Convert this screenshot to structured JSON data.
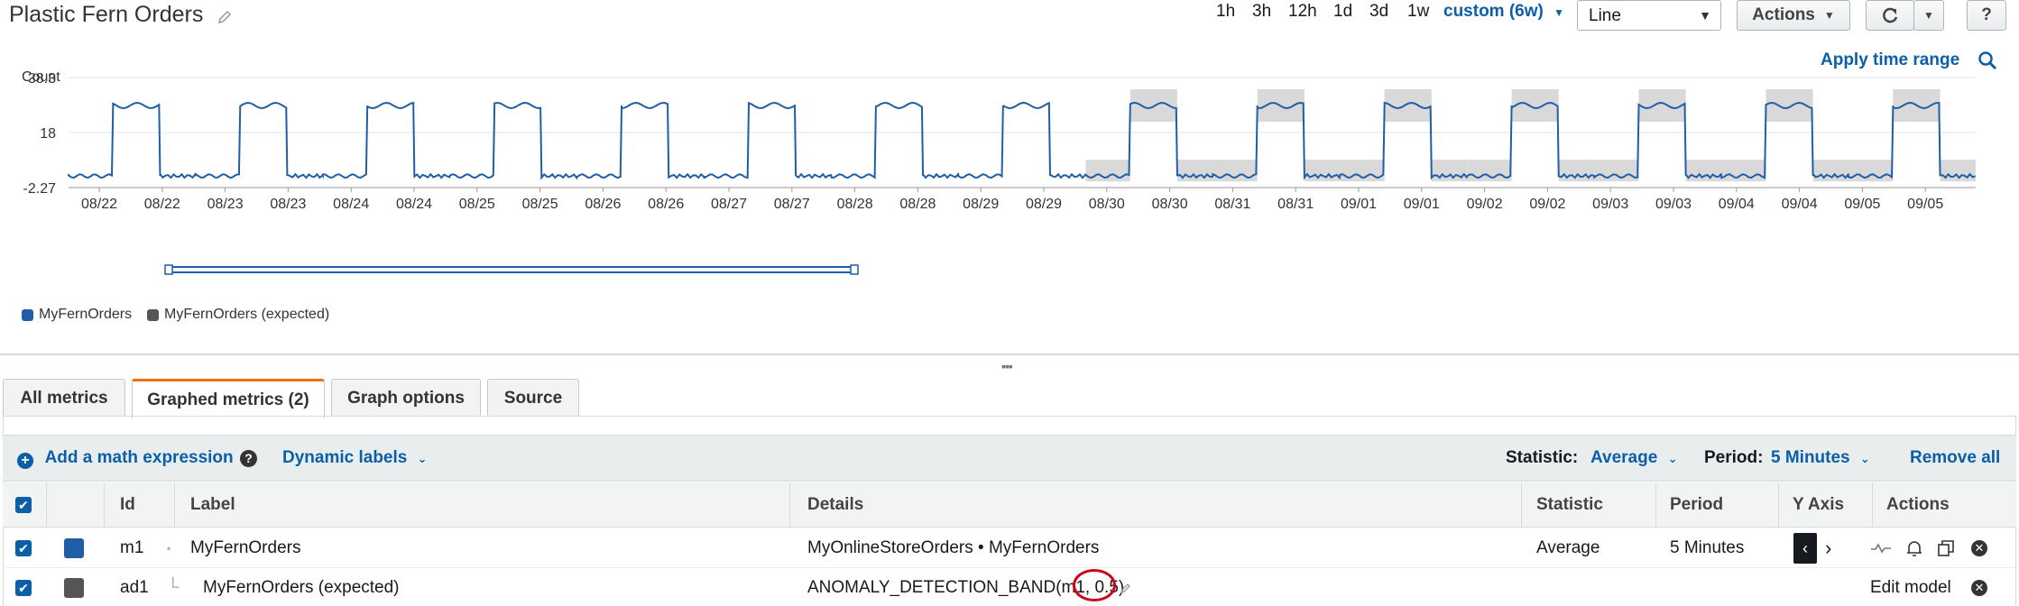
{
  "header": {
    "title": "Plastic Fern Orders",
    "time_ranges": [
      "1h",
      "3h",
      "12h",
      "1d",
      "3d",
      "1w"
    ],
    "custom_range": "custom (6w)",
    "graph_type": "Line",
    "actions_label": "Actions",
    "help_label": "?",
    "apply_time_range": "Apply time range"
  },
  "chart_data": {
    "type": "line",
    "ylabel": "Count",
    "yticks": [
      "38.3",
      "18",
      "-2.27"
    ],
    "ylim": [
      -2.27,
      38.3
    ],
    "x_tick_labels": [
      "08/22",
      "08/22",
      "08/23",
      "08/23",
      "08/24",
      "08/24",
      "08/25",
      "08/25",
      "08/26",
      "08/26",
      "08/27",
      "08/27",
      "08/28",
      "08/28",
      "08/29",
      "08/29",
      "08/30",
      "08/30",
      "08/31",
      "08/31",
      "09/01",
      "09/01",
      "09/02",
      "09/02",
      "09/03",
      "09/03",
      "09/04",
      "09/04",
      "09/05",
      "09/05"
    ],
    "pattern": {
      "low": 2,
      "high": 28,
      "cycles": 15,
      "high_fraction": 0.37
    },
    "band": {
      "start_cycle": 9,
      "low_band": [
        0,
        8
      ],
      "high_band": [
        22,
        34
      ]
    },
    "series": [
      {
        "name": "MyFernOrders",
        "color": "#1f5fa6"
      },
      {
        "name": "MyFernOrders (expected)",
        "color": "#555555"
      }
    ]
  },
  "tabs": [
    {
      "label": "All metrics"
    },
    {
      "label": "Graphed metrics (2)"
    },
    {
      "label": "Graph options"
    },
    {
      "label": "Source"
    }
  ],
  "toolbar": {
    "add_math": "Add a math expression",
    "dynamic_labels": "Dynamic labels",
    "statistic_label": "Statistic:",
    "statistic_value": "Average",
    "period_label": "Period:",
    "period_value": "5 Minutes",
    "remove_all": "Remove all"
  },
  "table": {
    "headers": [
      "Id",
      "Label",
      "Details",
      "Statistic",
      "Period",
      "Y Axis",
      "Actions"
    ],
    "rows": [
      {
        "id": "m1",
        "label": "MyFernOrders",
        "details": "MyOnlineStoreOrders • MyFernOrders",
        "statistic": "Average",
        "period": "5 Minutes",
        "color": "#1f5fa6"
      },
      {
        "id": "ad1",
        "label": "MyFernOrders (expected)",
        "details": "ANOMALY_DETECTION_BAND(m1, 0.5)",
        "statistic": "",
        "period": "",
        "color": "#555555",
        "action_link": "Edit model"
      }
    ]
  }
}
